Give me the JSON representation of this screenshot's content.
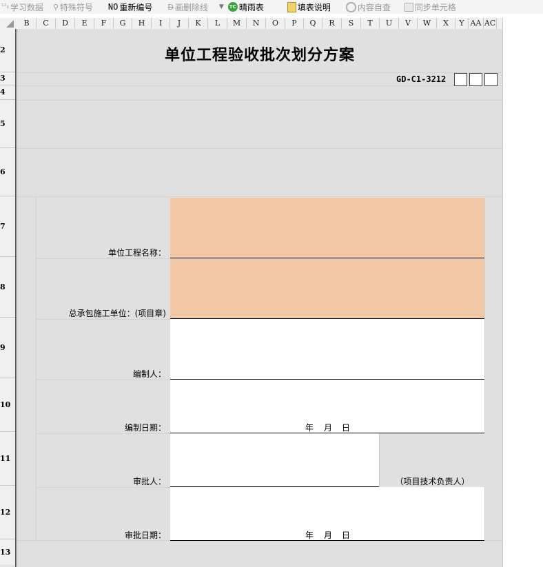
{
  "toolbar": {
    "items": [
      {
        "icon": "123-icon",
        "label": "学习数据",
        "enabled": false
      },
      {
        "icon": "special-symbol-icon",
        "label": "特殊符号",
        "enabled": false
      },
      {
        "icon": "no-icon",
        "icon_text": "NO",
        "label": "重新编号",
        "enabled": true
      },
      {
        "icon": "strikethrough-icon",
        "label": "画删除线",
        "enabled": false
      },
      {
        "icon": "weather-icon",
        "icon_text": "TC",
        "label": "晴雨表",
        "enabled": true
      },
      {
        "icon": "form-note-icon",
        "label": "填表说明",
        "enabled": true
      },
      {
        "icon": "magnifier-icon",
        "label": "内容自查",
        "enabled": false
      },
      {
        "icon": "sync-cell-icon",
        "label": "同步单元格",
        "enabled": false
      }
    ]
  },
  "columns": [
    "B",
    "C",
    "D",
    "E",
    "F",
    "G",
    "H",
    "I",
    "J",
    "K",
    "L",
    "M",
    "N",
    "O",
    "P",
    "Q",
    "R",
    "S",
    "T",
    "U",
    "V",
    "W",
    "X",
    "Y",
    "AA",
    "AC"
  ],
  "rows": [
    "2",
    "3",
    "4",
    "5",
    "6",
    "7",
    "8",
    "9",
    "10",
    "11",
    "12",
    "13"
  ],
  "document": {
    "title": "单位工程验收批次划分方案",
    "code": "GD-C1-3212",
    "fields": {
      "project_name_label": "单位工程名称：",
      "contractor_label": "总承包施工单位：(项目章)",
      "preparer_label": "编制人：",
      "prepare_date_label": "编制日期：",
      "approver_label": "审批人：",
      "approve_date_label": "审批日期：",
      "tech_lead_note": "（项目技术负责人）",
      "year": "年",
      "month": "月",
      "day": "日"
    }
  },
  "colors": {
    "input_fill": "#f0c8a6",
    "sheet_bg": "#e0e0e0",
    "weather_icon": "#3aa63a"
  }
}
